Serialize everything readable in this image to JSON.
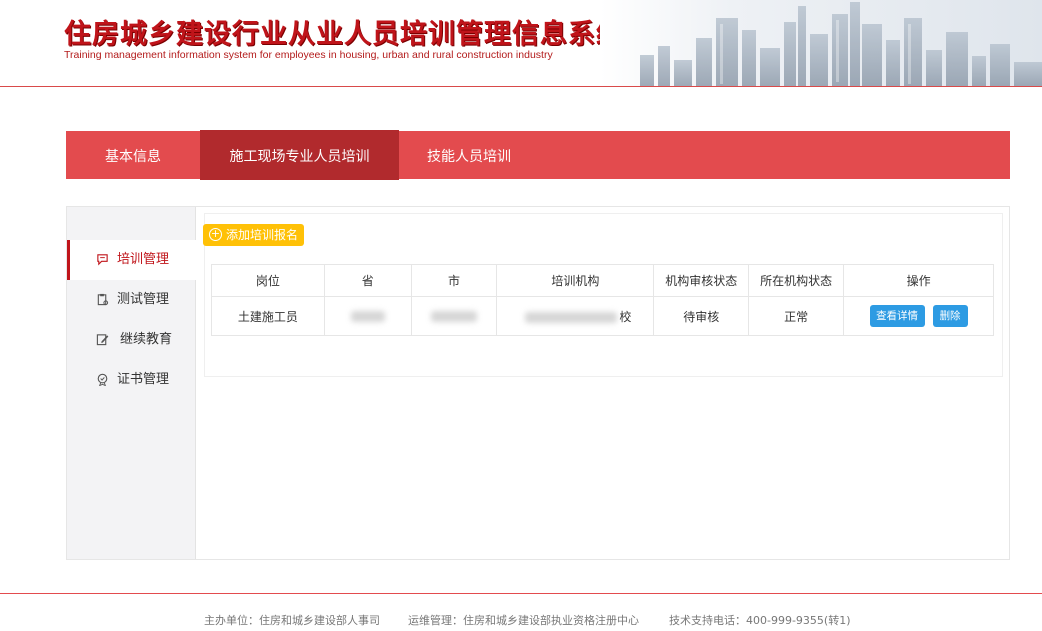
{
  "header": {
    "title_cn": "住房城乡建设行业从业人员培训管理信息系统",
    "title_en": "Training management information system for employees in housing, urban and rural construction industry"
  },
  "tabs": [
    {
      "label": "基本信息"
    },
    {
      "label": "施工现场专业人员培训",
      "active": true
    },
    {
      "label": "技能人员培训"
    }
  ],
  "sidebar": {
    "items": [
      {
        "label": "培训管理",
        "icon": "chat-icon",
        "active": true
      },
      {
        "label": "测试管理",
        "icon": "clipboard-icon"
      },
      {
        "label": "继续教育",
        "icon": "edit-icon"
      },
      {
        "label": "证书管理",
        "icon": "certificate-icon"
      }
    ]
  },
  "toolbar": {
    "add_label": "添加培训报名"
  },
  "table": {
    "headers": [
      "岗位",
      "省",
      "市",
      "培训机构",
      "机构审核状态",
      "所在机构状态",
      "操作"
    ],
    "rows": [
      {
        "position": "土建施工员",
        "institution_suffix": "校",
        "audit_status": "待审核",
        "inst_status": "正常",
        "detail_label": "查看详情",
        "delete_label": "删除"
      }
    ]
  },
  "footer": {
    "host": "主办单位：住房和城乡建设部人事司",
    "ops": "运维管理：住房和城乡建设部执业资格注册中心",
    "support": "技术支持电话：400-999-9355(转1)"
  },
  "colors": {
    "brand_red": "#e34b4e",
    "active_tab": "#b12a2d",
    "accent_yellow": "#ffc107",
    "button_blue": "#2d9be3"
  }
}
